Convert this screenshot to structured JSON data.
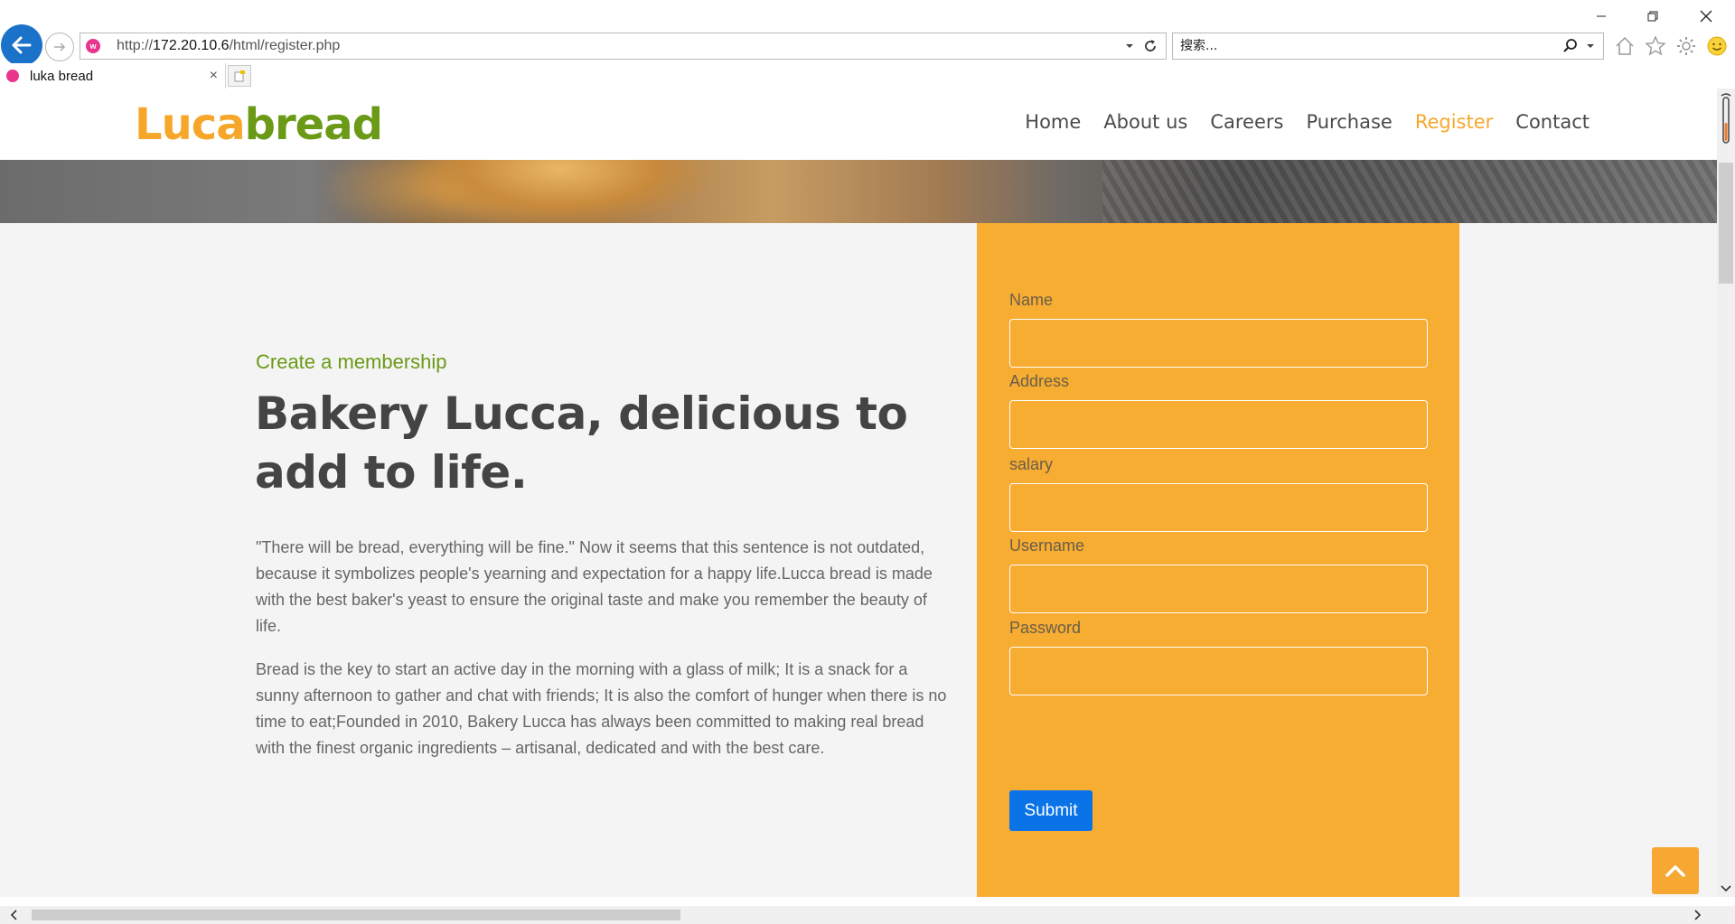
{
  "browser": {
    "url_prefix": "http://",
    "url_host": "172.20.10.6",
    "url_path": "/html/register.php",
    "search_placeholder": "搜索...",
    "tab_title": "luka bread",
    "tab_close": "×"
  },
  "site": {
    "logo_part1": "Luca",
    "logo_part2": "bread",
    "nav": {
      "home": "Home",
      "about": "About us",
      "careers": "Careers",
      "purchase": "Purchase",
      "register": "Register",
      "contact": "Contact"
    },
    "active_nav": "Register"
  },
  "content": {
    "kicker": "Create a membership",
    "headline": "Bakery Lucca, delicious to add to life.",
    "paragraph1": "\"There will be bread, everything will be fine.\" Now it seems that this sentence is not outdated, because it symbolizes people's yearning and expectation for a happy life.Lucca bread is made with the best baker's yeast to ensure the original taste and make you remember the beauty of life.",
    "paragraph2": "Bread is the key to start an active day in the morning with a glass of milk; It is a snack for a sunny afternoon to gather and chat with friends; It is also the comfort of hunger when there is no time to eat;Founded in 2010, Bakery Lucca has always been committed to making real bread with the finest organic ingredients – artisanal, dedicated and with the best care."
  },
  "form": {
    "name_label": "Name",
    "name_value": "",
    "address_label": "Address",
    "address_value": "",
    "salary_label": "salary",
    "salary_value": "",
    "username_label": "Username",
    "username_value": "",
    "password_label": "Password",
    "password_value": "",
    "submit_label": "Submit"
  },
  "icons": {
    "back": "arrow-left-icon",
    "forward": "arrow-right-icon",
    "refresh": "refresh-icon",
    "search": "search-icon",
    "home": "home-icon",
    "favorites": "star-icon",
    "settings": "gear-icon",
    "feedback": "smiley-icon",
    "back_to_top": "chevron-up-icon"
  },
  "colors": {
    "brand_orange": "#f6a72a",
    "brand_green": "#6a9a16",
    "form_panel": "#f7ac32",
    "submit_button": "#0a73e8",
    "browser_back": "#1a73c8"
  }
}
